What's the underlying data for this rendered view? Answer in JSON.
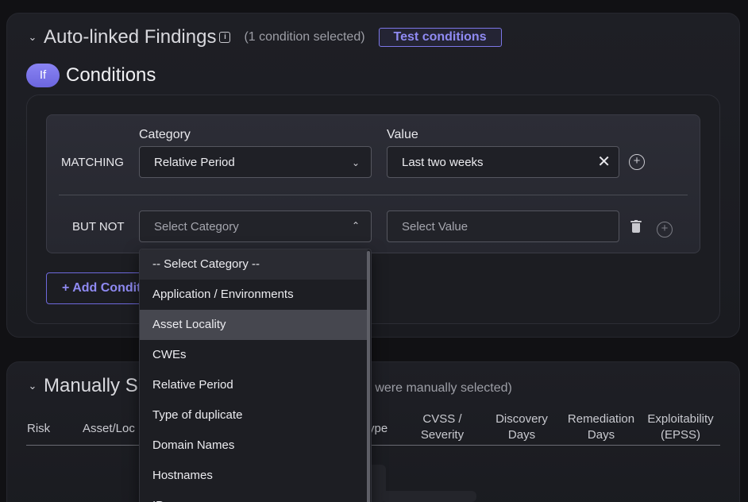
{
  "auto_linked": {
    "title": "Auto-linked Findings",
    "note": "(1 condition selected)",
    "test_button": "Test conditions"
  },
  "conditions": {
    "if_label": "If",
    "title": "Conditions",
    "category_label": "Category",
    "value_label": "Value",
    "rows": [
      {
        "label": "MATCHING",
        "category": "Relative Period",
        "value": "Last two weeks"
      },
      {
        "label": "BUT NOT",
        "category_placeholder": "Select Category",
        "value_placeholder": "Select Value"
      }
    ],
    "add_button": "+ Add Condition"
  },
  "category_dropdown": {
    "options": [
      "-- Select Category --",
      "Application / Environments",
      "Asset Locality",
      "CWEs",
      "Relative Period",
      "Type of duplicate",
      "Domain Names",
      "Hostnames",
      "IPs"
    ],
    "hovered": "Asset Locality"
  },
  "manually_selected": {
    "title": "Manually S",
    "note": "ns were manually selected)",
    "columns": {
      "risk": "Risk",
      "asset": "Asset/Loc",
      "type": "ype",
      "cvss_1": "CVSS /",
      "cvss_2": "Severity",
      "discovery_1": "Discovery",
      "discovery_2": "Days",
      "remediation_1": "Remediation",
      "remediation_2": "Days",
      "epss_1": "Exploitability",
      "epss_2": "(EPSS)"
    }
  },
  "colors": {
    "accent": "#7c77e8",
    "background": "#111114",
    "panel": "#1e1f25"
  }
}
